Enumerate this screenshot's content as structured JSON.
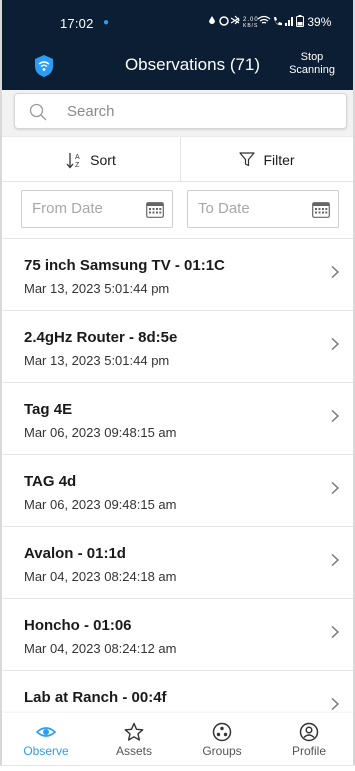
{
  "status_bar": {
    "time": "17:02",
    "icons": "▵ ◎ ✱ 2.00 ◔ ☎ ..",
    "battery": "39%"
  },
  "app_bar": {
    "title": "Observations (71)",
    "stop_label_line1": "Stop",
    "stop_label_line2": "Scanning"
  },
  "search": {
    "placeholder": "Search",
    "value": ""
  },
  "sort_label": "Sort",
  "filter_label": "Filter",
  "dates": {
    "from_placeholder": "From Date",
    "to_placeholder": "To Date"
  },
  "observations": [
    {
      "title": "75 inch Samsung TV - 01:1C",
      "time": "Mar 13, 2023 5:01:44 pm"
    },
    {
      "title": "2.4gHz Router - 8d:5e",
      "time": "Mar 13, 2023 5:01:44 pm"
    },
    {
      "title": "Tag 4E",
      "time": "Mar 06, 2023 09:48:15 am"
    },
    {
      "title": "TAG 4d",
      "time": "Mar 06, 2023 09:48:15 am"
    },
    {
      "title": "Avalon - 01:1d",
      "time": "Mar 04, 2023 08:24:18 am"
    },
    {
      "title": "Honcho - 01:06",
      "time": "Mar 04, 2023 08:24:12 am"
    },
    {
      "title": "Lab at Ranch - 00:4f",
      "time": ""
    }
  ],
  "nav": [
    {
      "label": "Observe",
      "icon": "eye-icon",
      "active": true
    },
    {
      "label": "Assets",
      "icon": "star-icon",
      "active": false
    },
    {
      "label": "Groups",
      "icon": "groups-icon",
      "active": false
    },
    {
      "label": "Profile",
      "icon": "profile-icon",
      "active": false
    }
  ],
  "colors": {
    "header_bg": "#0b1e33",
    "accent": "#2a9df4"
  }
}
